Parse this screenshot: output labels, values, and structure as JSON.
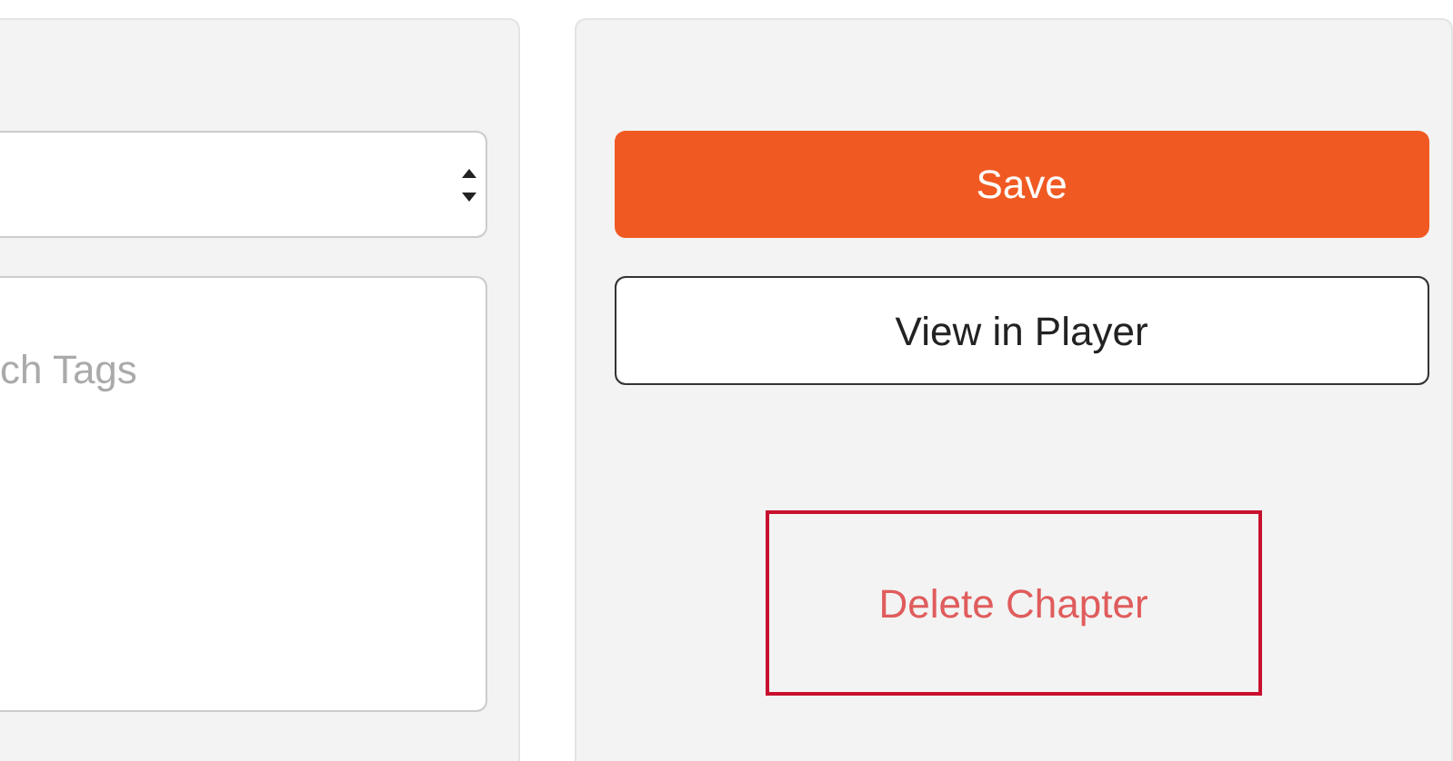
{
  "tags_field": {
    "placeholder": "ch Tags"
  },
  "actions": {
    "save": "Save",
    "view": "View in Player",
    "delete": "Delete Chapter"
  }
}
